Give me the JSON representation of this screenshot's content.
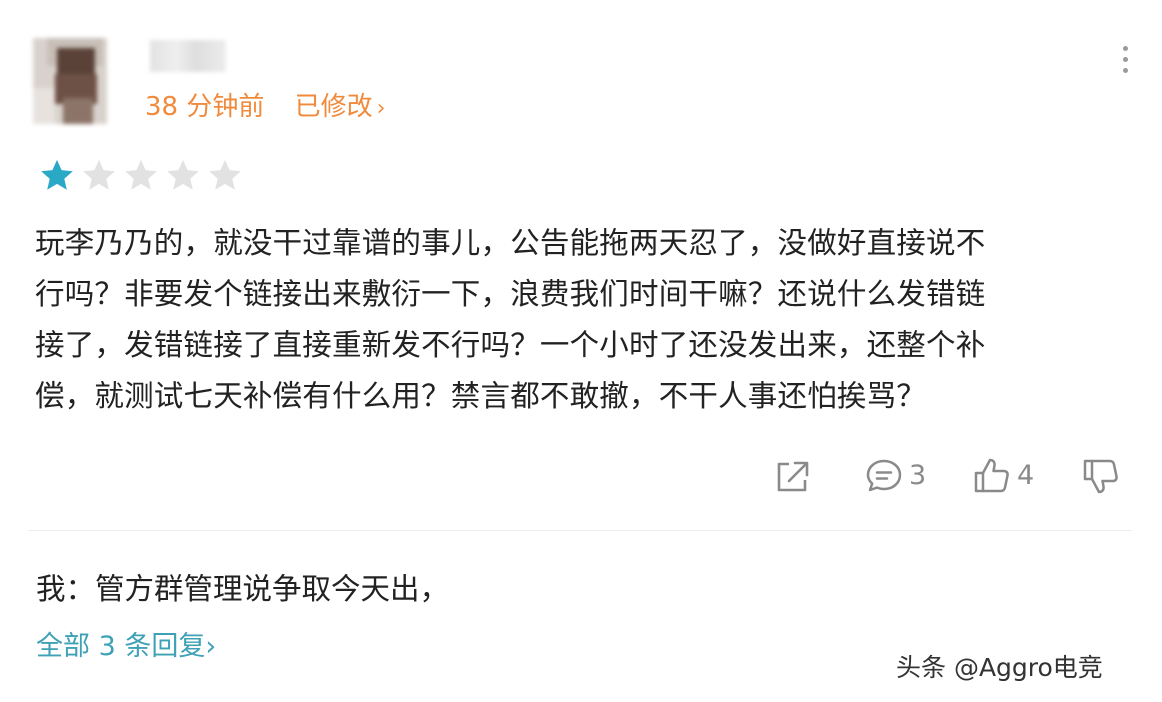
{
  "comment": {
    "time": "38 分钟前",
    "edited": "已修改",
    "edited_chevron": "›",
    "rating": 1,
    "rating_max": 5,
    "rating_color_active": "#2aa9c6",
    "rating_color_inactive": "#e2e2e2",
    "lines": [
      "玩李乃乃的，就没干过靠谱的事儿，公告能拖两天忍了，没做好直接说不",
      "行吗？非要发个链接出来敷衍一下，浪费我们时间干嘛？还说什么发错链",
      "接了，发错链接了直接重新发不行吗？一个小时了还没发出来，还整个补",
      "偿，就测试七天补偿有什么用？禁言都不敢撤，不干人事还怕挨骂？"
    ]
  },
  "actions": {
    "share_icon": "share-icon",
    "reply_icon": "comment-bubble-icon",
    "reply_count": "3",
    "like_icon": "thumbs-up-icon",
    "like_count": "4",
    "dislike_icon": "thumbs-down-icon"
  },
  "reply": {
    "text": "我：管方群管理说争取今天出，",
    "all_replies": "全部 3 条回复",
    "all_replies_chevron": "›"
  },
  "watermark": "头条 @Aggro电竞",
  "colors": {
    "accent_orange": "#f08a3c",
    "accent_teal": "#3ea1b6",
    "icon_gray": "#8a8a8a"
  }
}
